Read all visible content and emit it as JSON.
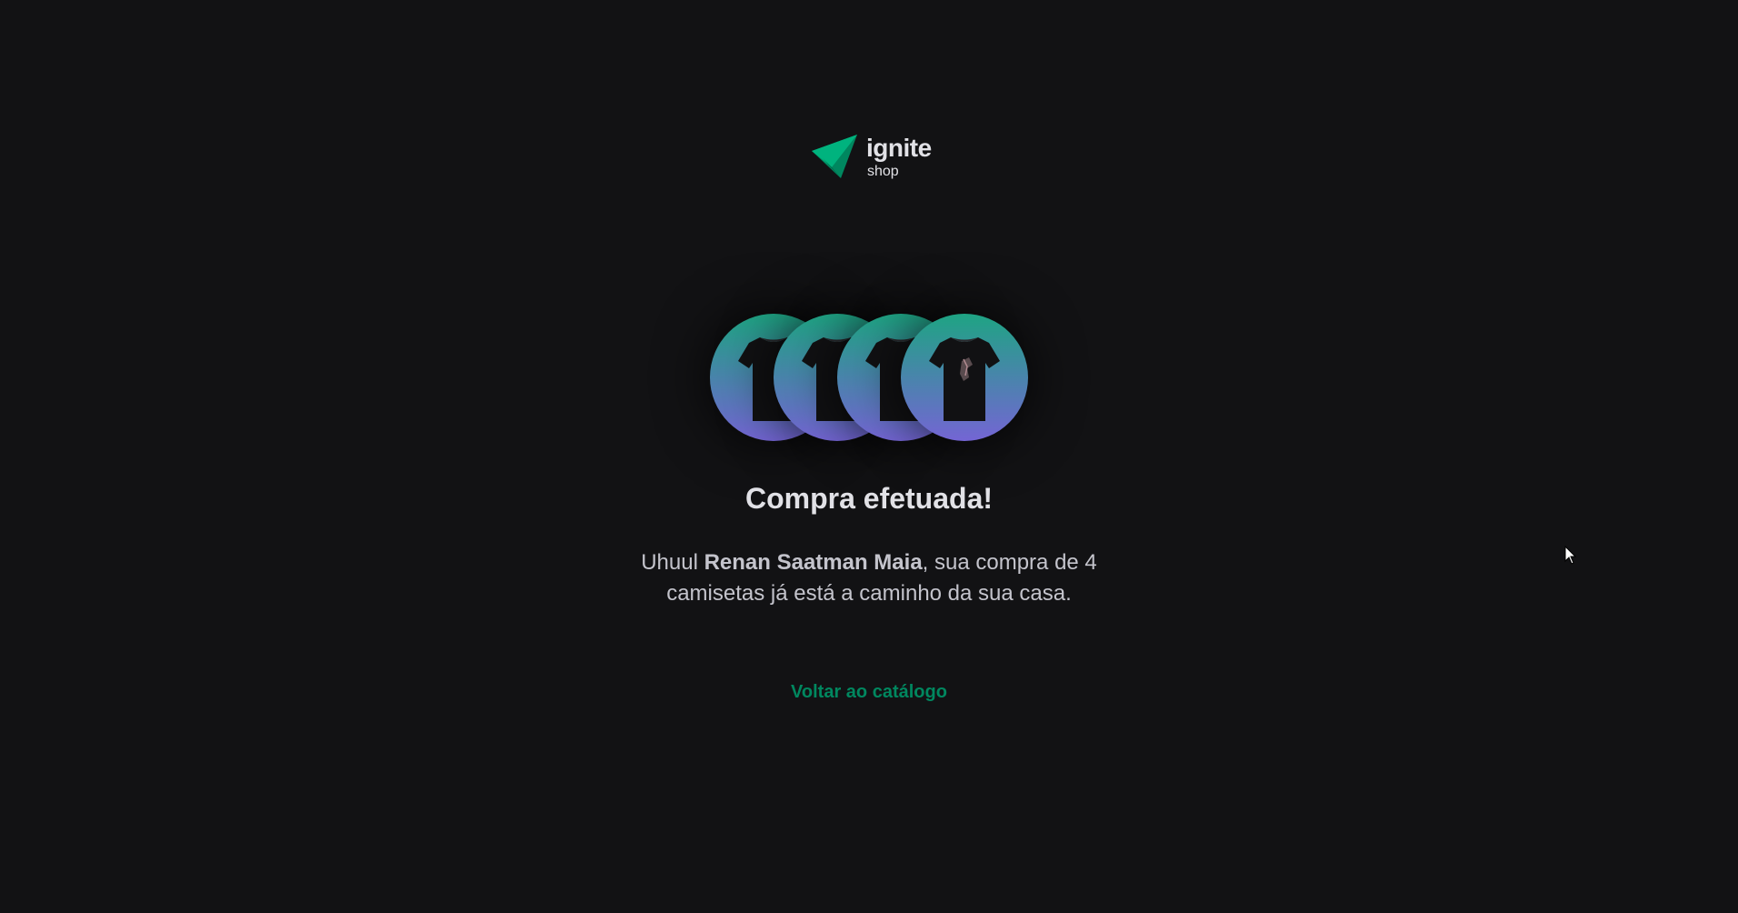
{
  "brand": {
    "name": "ignite",
    "sub": "shop",
    "logo_icon": "ignite-logo-icon",
    "accent_color": "#00875f",
    "logo_colors": [
      "#00875f",
      "#00b37e"
    ]
  },
  "products": [
    {
      "name": "tshirt-icon"
    },
    {
      "name": "tshirt-icon"
    },
    {
      "name": "tshirt-icon"
    },
    {
      "name": "tshirt-icon"
    }
  ],
  "success": {
    "title": "Compra efetuada!",
    "message_prefix": "Uhuul ",
    "customer_name": "Renan Saatman Maia",
    "message_suffix": ", sua compra de 4 camisetas já está a caminho da sua casa."
  },
  "actions": {
    "back_label": "Voltar ao catálogo"
  },
  "colors": {
    "background": "#121214",
    "circle_gradient": [
      "#1ea483",
      "#7465d4"
    ]
  }
}
